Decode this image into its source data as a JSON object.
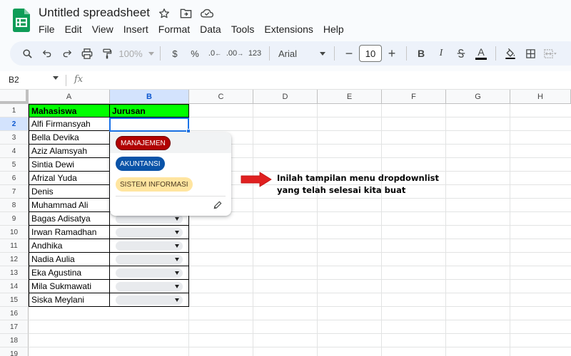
{
  "app": {
    "title": "Untitled spreadsheet"
  },
  "menu": [
    "File",
    "Edit",
    "View",
    "Insert",
    "Format",
    "Data",
    "Tools",
    "Extensions",
    "Help"
  ],
  "toolbar": {
    "zoom": "100%",
    "currency": "$",
    "percent": "%",
    "decrease_decimal": ".0",
    "increase_decimal": ".00",
    "number_format": "123",
    "font": "Arial",
    "font_size": "10",
    "minus": "−",
    "plus": "+",
    "bold": "B",
    "italic": "I",
    "text_color": "A"
  },
  "formula_bar": {
    "name_box": "B2",
    "fx": "fx"
  },
  "columns": [
    "A",
    "B",
    "C",
    "D",
    "E",
    "F",
    "G",
    "H"
  ],
  "rows": [
    "1",
    "2",
    "3",
    "4",
    "5",
    "6",
    "7",
    "8",
    "9",
    "10",
    "11",
    "12",
    "13",
    "14",
    "15",
    "16",
    "17",
    "18",
    "19"
  ],
  "sheet": {
    "header_a": "Mahasiswa",
    "header_b": "Jurusan",
    "names": [
      "Alfi Firmansyah",
      "Bella Devika",
      "Aziz Alamsyah",
      "Sintia Dewi",
      "Afrizal Yuda",
      "Denis",
      "Muhammad Ali",
      "Bagas Adisatya",
      "Irwan Ramadhan",
      "Andhika",
      "Nadia Aulia",
      "Eka Agustina",
      "Mila Sukmawati",
      "Siska Meylani"
    ]
  },
  "dropdown": {
    "options": [
      "MANAJEMEN",
      "AKUNTANSI",
      "SISTEM INFORMASI"
    ],
    "option_colors": [
      "#b10202",
      "#0a53a8",
      "#ffe5a0"
    ]
  },
  "annotation": {
    "line1": "Inilah tampilan menu dropdownlist",
    "line2": "yang telah selesai kita buat"
  },
  "colors": {
    "header_fill": "#00ff00",
    "selection": "#1a73e8",
    "arrow": "#e02020"
  }
}
